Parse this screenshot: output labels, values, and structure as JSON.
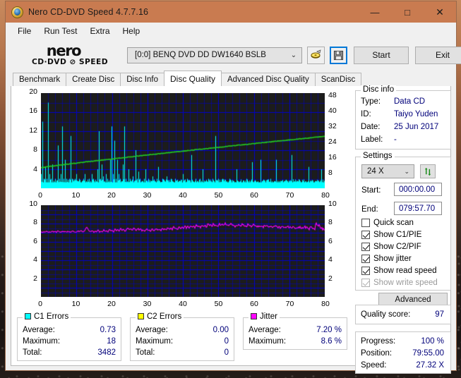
{
  "window": {
    "title": "Nero CD-DVD Speed 4.7.7.16",
    "icon": "nero-disc-icon",
    "minimize": "—",
    "maximize": "□",
    "close": "✕"
  },
  "menubar": {
    "items": [
      {
        "label": "File"
      },
      {
        "label": "Run Test"
      },
      {
        "label": "Extra"
      },
      {
        "label": "Help"
      }
    ]
  },
  "logo": {
    "line1": "nero",
    "line2": "CD·DVD ⊘ SPEED"
  },
  "toolbar": {
    "drive": "[0:0]   BENQ DVD DD DW1640 BSLB",
    "drive_chevron": "⌄",
    "eject_icon": "eject-disc-icon",
    "save_icon": "save-floppy-icon",
    "start_label": "Start",
    "exit_label": "Exit"
  },
  "tabs": [
    {
      "label": "Benchmark",
      "active": false
    },
    {
      "label": "Create Disc",
      "active": false
    },
    {
      "label": "Disc Info",
      "active": false
    },
    {
      "label": "Disc Quality",
      "active": true
    },
    {
      "label": "Advanced Disc Quality",
      "active": false
    },
    {
      "label": "ScanDisc",
      "active": false
    }
  ],
  "disc_info": {
    "legend": "Disc info",
    "rows": [
      {
        "key": "Type:",
        "value": "Data CD"
      },
      {
        "key": "ID:",
        "value": "Taiyo Yuden"
      },
      {
        "key": "Date:",
        "value": "25 Jun 2017"
      },
      {
        "key": "Label:",
        "value": "-"
      }
    ]
  },
  "settings": {
    "legend": "Settings",
    "speed": "24 X",
    "speed_chevron": "⌄",
    "refresh_icon": "refresh-speed-icon",
    "start_label": "Start:",
    "start_value": "000:00.00",
    "end_label": "End:",
    "end_value": "079:57.70",
    "checkboxes": [
      {
        "label": "Quick scan",
        "checked": false,
        "disabled": false
      },
      {
        "label": "Show C1/PIE",
        "checked": true,
        "disabled": false
      },
      {
        "label": "Show C2/PIF",
        "checked": true,
        "disabled": false
      },
      {
        "label": "Show jitter",
        "checked": true,
        "disabled": false
      },
      {
        "label": "Show read speed",
        "checked": true,
        "disabled": false
      },
      {
        "label": "Show write speed",
        "checked": true,
        "disabled": true
      }
    ],
    "advanced_label": "Advanced"
  },
  "quality": {
    "label": "Quality score:",
    "value": "97"
  },
  "progress": {
    "rows": [
      {
        "key": "Progress:",
        "value": "100 %"
      },
      {
        "key": "Position:",
        "value": "79:55.00"
      },
      {
        "key": "Speed:",
        "value": "27.32 X"
      }
    ]
  },
  "stats": [
    {
      "legend": "C1 Errors",
      "color": "#00ffff",
      "rows": [
        {
          "key": "Average:",
          "value": "0.73"
        },
        {
          "key": "Maximum:",
          "value": "18"
        },
        {
          "key": "Total:",
          "value": "3482"
        }
      ]
    },
    {
      "legend": "C2 Errors",
      "color": "#ffff00",
      "rows": [
        {
          "key": "Average:",
          "value": "0.00"
        },
        {
          "key": "Maximum:",
          "value": "0"
        },
        {
          "key": "Total:",
          "value": "0"
        }
      ]
    },
    {
      "legend": "Jitter",
      "color": "#ff00ff",
      "rows": [
        {
          "key": "Average:",
          "value": "7.20 %"
        },
        {
          "key": "Maximum:",
          "value": "8.6 %"
        }
      ]
    }
  ],
  "chart_data": [
    {
      "type": "area",
      "name": "c1-errors-chart",
      "title": "",
      "xlabel": "",
      "ylabel": "",
      "xlim": [
        0,
        80
      ],
      "ylim": [
        0,
        20
      ],
      "y2lim": [
        0,
        50
      ],
      "xticks": [
        0,
        10,
        20,
        30,
        40,
        50,
        60,
        70,
        80
      ],
      "yticks": [
        4,
        8,
        12,
        16,
        20
      ],
      "y2ticks": [
        8,
        16,
        24,
        32,
        40,
        48
      ],
      "grid": true,
      "bg": "#1c1c1c",
      "gridcolor": "#0000cd",
      "series": [
        {
          "name": "C1 Errors",
          "color": "#00ffff",
          "kind": "spike-area",
          "values": [
            3.0,
            14.0,
            2.0,
            4.5,
            2.0,
            18.0,
            3.0,
            2.0,
            5.0,
            1.5,
            2.0,
            1.2,
            9.0,
            2.0,
            3.0,
            13.0,
            2.0,
            6.0,
            2.0,
            1.5,
            2.0,
            11.0,
            2.0,
            1.5,
            2.0,
            3.0,
            1.5,
            2.0,
            1.2,
            1.5,
            2.0,
            3.0,
            1.5,
            1.2,
            2.0,
            1.5,
            3.0,
            2.0,
            1.2,
            1.5,
            4.0,
            12.0,
            2.0,
            5.0,
            2.5,
            1.5,
            3.0,
            2.0,
            1.5,
            6.0,
            13.0,
            3.0,
            10.0,
            2.0,
            6.0,
            3.0,
            2.0,
            1.5,
            5.0,
            13.0,
            2.0,
            1.5,
            4.0,
            2.0,
            1.2,
            2.5,
            1.5,
            8.0,
            2.0,
            3.5,
            2.0,
            1.2,
            1.5,
            2.0,
            4.0,
            1.5,
            2.0,
            1.2,
            1.5,
            2.5,
            1.5,
            1.2,
            2.0,
            4.5,
            1.5,
            1.2,
            2.0,
            1.5,
            1.2,
            2.5,
            1.5,
            1.2,
            2.0,
            1.5,
            1.2,
            2.0,
            1.5,
            1.2,
            1.5,
            1.2,
            3.0,
            1.5,
            1.2,
            2.0,
            1.5,
            1.2,
            7.0,
            1.5,
            1.2,
            2.0,
            1.5,
            1.2,
            2.0,
            1.5,
            4.0,
            1.2,
            1.5,
            1.2,
            2.0,
            1.5,
            1.2,
            2.0,
            1.5,
            11.0,
            1.2,
            2.0,
            1.5,
            1.2,
            2.0,
            1.5,
            1.2,
            1.5,
            1.2,
            2.0,
            1.5,
            1.2,
            1.5,
            1.2,
            4.0,
            1.5,
            1.2,
            1.5,
            1.2,
            1.5,
            1.2,
            2.0,
            1.5,
            1.2,
            1.5,
            5.5,
            1.2,
            1.5,
            1.2,
            1.5,
            1.2,
            6.0,
            1.5,
            1.2,
            1.5,
            1.2,
            1.5,
            1.2,
            2.0,
            1.5,
            1.2,
            1.5,
            6.0,
            1.2,
            1.5,
            1.2,
            1.5,
            1.2,
            1.5,
            1.2,
            1.5,
            1.2,
            1.5,
            7.0,
            1.2,
            1.5,
            1.2,
            1.5,
            1.2,
            1.5,
            1.2,
            1.5,
            1.2,
            1.5,
            1.2,
            4.5,
            1.5,
            1.2,
            1.5,
            1.2,
            1.5,
            1.2,
            1.5,
            1.2,
            4.0,
            1.5
          ]
        },
        {
          "name": "Read speed",
          "color": "#22cc22",
          "kind": "line",
          "axis": "right",
          "start_value": 10.8,
          "end_value": 27.3
        }
      ]
    },
    {
      "type": "line",
      "name": "jitter-chart",
      "title": "",
      "xlabel": "",
      "ylabel": "",
      "xlim": [
        0,
        80
      ],
      "ylim": [
        0,
        10
      ],
      "y2lim": [
        0,
        10
      ],
      "xticks": [
        0,
        10,
        20,
        30,
        40,
        50,
        60,
        70,
        80
      ],
      "yticks": [
        2,
        4,
        6,
        8,
        10
      ],
      "y2ticks": [
        2,
        4,
        6,
        8,
        10
      ],
      "grid": true,
      "bg": "#1c1c1c",
      "gridcolor": "#0000cd",
      "series": [
        {
          "name": "Jitter",
          "color": "#ff00ff",
          "kind": "line",
          "baseline": 7.1,
          "values": [
            7.1,
            7.05,
            7.12,
            7.08,
            7.15,
            7.05,
            7.1,
            7.06,
            7.18,
            7.08,
            7.12,
            7.05,
            7.2,
            7.1,
            7.06,
            7.14,
            7.08,
            7.12,
            7.05,
            7.16,
            7.1,
            7.06,
            7.22,
            7.08,
            7.12,
            7.05,
            7.18,
            7.1,
            7.25,
            7.08,
            7.12,
            7.3,
            7.7,
            7.35,
            7.15,
            7.1,
            7.25,
            7.05,
            7.2,
            7.12,
            7.3,
            7.1,
            7.18,
            7.08,
            7.35,
            7.15,
            7.22,
            7.1,
            7.4,
            7.18,
            7.3,
            7.12,
            7.45,
            7.2,
            7.35,
            7.15,
            7.5,
            7.25,
            7.4,
            7.18,
            7.35,
            7.55,
            7.3,
            7.45,
            7.2,
            7.6,
            7.35,
            7.25,
            7.5,
            7.3,
            7.4,
            7.2,
            7.35,
            7.15,
            7.45,
            7.25,
            7.3,
            7.18,
            7.4,
            7.22,
            7.35,
            7.5,
            7.28,
            7.42,
            7.2,
            7.55,
            7.32,
            7.45,
            7.25,
            7.6,
            7.38,
            7.5,
            7.3,
            7.65,
            7.42,
            7.55,
            7.35,
            7.7,
            7.48,
            7.6,
            7.4,
            7.75,
            7.52,
            7.65,
            7.45,
            7.8,
            7.58,
            7.7,
            7.5,
            7.85,
            7.62,
            7.75,
            7.55,
            7.9,
            7.68,
            7.8,
            7.58,
            7.95,
            7.72,
            7.85,
            7.6,
            8.0,
            7.75,
            7.88,
            7.65,
            8.05,
            7.8,
            7.92,
            7.7,
            8.1,
            7.85,
            7.95,
            7.72,
            8.0,
            7.88,
            7.8,
            7.65,
            7.92,
            7.75,
            7.85,
            7.68,
            7.9,
            7.78,
            7.82,
            7.7,
            7.88,
            7.75,
            7.8,
            7.65,
            7.85,
            7.72,
            7.78,
            7.68,
            7.82,
            7.7,
            7.75,
            7.62,
            7.8,
            7.68,
            7.72,
            7.6,
            7.78,
            7.65,
            7.7,
            7.58,
            7.75,
            7.62,
            7.68,
            7.55,
            7.72,
            7.6,
            7.65,
            7.52,
            7.7,
            7.58,
            7.62,
            7.5,
            7.68,
            7.55,
            7.6,
            7.48,
            7.65,
            7.52,
            7.58,
            7.45,
            7.62,
            7.5,
            7.55,
            7.42,
            7.6,
            7.48,
            7.52,
            7.4,
            8.05,
            7.9,
            7.75,
            7.6,
            7.45,
            7.35,
            7.3
          ]
        }
      ]
    }
  ]
}
